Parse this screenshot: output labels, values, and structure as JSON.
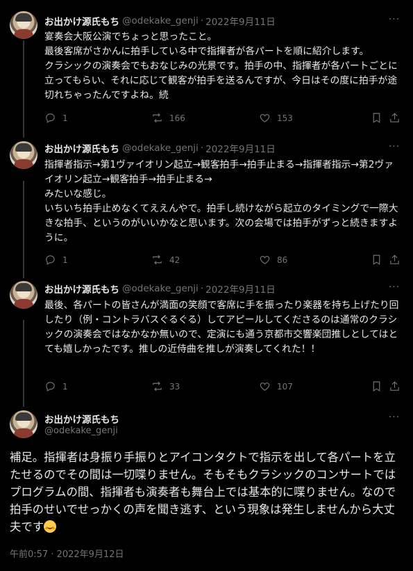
{
  "tweets": [
    {
      "name": "お出かけ源氏もち",
      "handle": "@odekake_genji",
      "date": "2022年9月11日",
      "text": "宴奏会大阪公演でちょっと思ったこと。\n最後客席がさかんに拍手している中で指揮者が各パートを順に紹介します。\nクラシックの演奏会でもおなじみの光景です。拍手の中、指揮者が各パートごとに立ってもらい、それに応じて観客が拍手を送るんですが、今日はその度に拍手が途切れちゃったんですよね。続",
      "replies": "1",
      "retweets": "166",
      "likes": "153"
    },
    {
      "name": "お出かけ源氏もち",
      "handle": "@odekake_genji",
      "date": "2022年9月11日",
      "text": "指揮者指示→第1ヴァイオリン起立→観客拍手→拍手止まる→指揮者指示→第2ヴァイオリン起立→観客拍手→拍手止まる→\nみたいな感じ。\nいちいち拍手止めなくてええんやで。拍手し続けながら起立のタイミングで一際大きな拍手、というのがいいかなと思います。次の会場では拍手がずっと続きますように。",
      "replies": "1",
      "retweets": "42",
      "likes": "86"
    },
    {
      "name": "お出かけ源氏もち",
      "handle": "@odekake_genji",
      "date": "2022年9月11日",
      "text": "最後、各パートの皆さんが満面の笑顔で客席に手を振ったり楽器を持ち上げたり回したり（例・コントラバスぐるぐる）してアピールしてくださるのは通常のクラシックの演奏会ではなかなか無いので、定演にも通う京都市交響楽団推しとしてはとても嬉しかったです。推しの近侍曲を推しが演奏してくれた！！",
      "replies": "1",
      "retweets": "33",
      "likes": "107"
    }
  ],
  "main": {
    "name": "お出かけ源氏もち",
    "handle": "@odekake_genji",
    "text": "補足。指揮者は身振り手振りとアイコンタクトで指示を出して各パートを立たせるのでその間は一切喋りません。そもそもクラシックのコンサートではプログラムの間、指揮者も演奏者も舞台上では基本的に喋りません。なので拍手のせいでせっかくの声を聞き逃す、という現象は発生しませんから大丈夫です",
    "emoji": "smiling-face-icon",
    "timestamp": "午前0:57 · 2022年9月12日"
  },
  "separator": "·",
  "colors": {
    "background": "#000000",
    "text": "#e7e9ea",
    "muted": "#71767b",
    "line": "#333639"
  }
}
